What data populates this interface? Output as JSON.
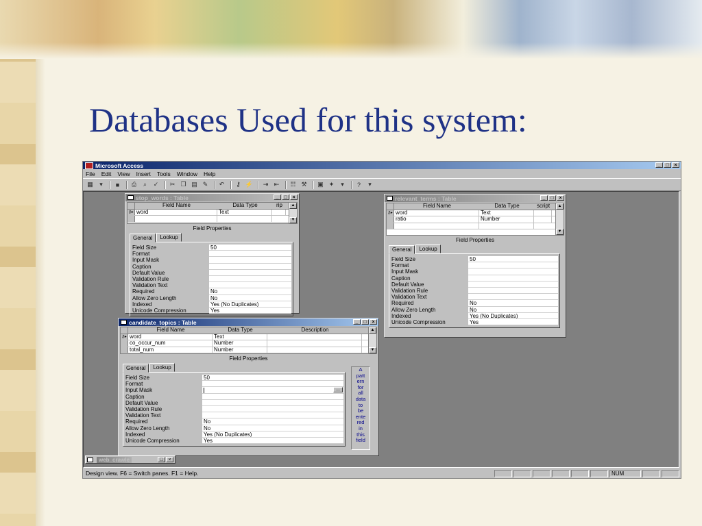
{
  "slide": {
    "title": "Databases Used for this system:"
  },
  "app": {
    "title": "Microsoft Access",
    "controls": {
      "minimize": "_",
      "restore": "□",
      "close": "×"
    }
  },
  "menu": [
    "File",
    "Edit",
    "View",
    "Insert",
    "Tools",
    "Window",
    "Help"
  ],
  "toolbar_icons": [
    "view-icon",
    "save-icon",
    "print-icon",
    "preview-icon",
    "spell-icon",
    "cut-icon",
    "copy-icon",
    "paste-icon",
    "format-painter-icon",
    "undo-icon",
    "primary-key-icon",
    "indexes-icon",
    "insert-row-icon",
    "delete-row-icon",
    "properties-icon",
    "build-icon",
    "database-window-icon",
    "new-object-icon",
    "help-icon"
  ],
  "status": {
    "text": "Design view.  F6 = Switch panes.  F1 = Help.",
    "num": "NUM"
  },
  "columns": {
    "field_name": "Field Name",
    "data_type": "Data Type",
    "description": "Description"
  },
  "field_properties_label": "Field Properties",
  "tabs": {
    "general": "General",
    "lookup": "Lookup"
  },
  "property_labels": [
    "Field Size",
    "Format",
    "Input Mask",
    "Caption",
    "Default Value",
    "Validation Rule",
    "Validation Text",
    "Required",
    "Allow Zero Length",
    "Indexed",
    "Unicode Compression"
  ],
  "windows": {
    "stop_words": {
      "title": "stop_words : Table",
      "desc_header": "rip",
      "rows": [
        {
          "name": "word",
          "type": "Text"
        }
      ],
      "properties": [
        "50",
        "",
        "",
        "",
        "",
        "",
        "",
        "No",
        "No",
        "Yes (No Duplicates)",
        "Yes"
      ]
    },
    "relevant_terms": {
      "title": "relevant_terms : Table",
      "desc_header": "script",
      "rows": [
        {
          "name": "word",
          "type": "Text"
        },
        {
          "name": "ratio",
          "type": "Number"
        }
      ],
      "properties": [
        "50",
        "",
        "",
        "",
        "",
        "",
        "",
        "No",
        "No",
        "Yes (No Duplicates)",
        "Yes"
      ]
    },
    "candidate_topics": {
      "title": "candidate_topics : Table",
      "rows": [
        {
          "name": "word",
          "type": "Text"
        },
        {
          "name": "co_occur_num",
          "type": "Number"
        },
        {
          "name": "total_num",
          "type": "Number"
        }
      ],
      "properties": [
        "50",
        "",
        "",
        "",
        "",
        "",
        "",
        "No",
        "No",
        "Yes (No Duplicates)",
        "Yes"
      ],
      "hint_lines": [
        "A",
        "patt",
        "ern",
        "for",
        "all",
        "data",
        "to",
        "be",
        "ente",
        "red",
        "in",
        "this",
        "field"
      ],
      "builder_button": "..."
    }
  },
  "minimized_window": {
    "title": "web_crawle"
  }
}
